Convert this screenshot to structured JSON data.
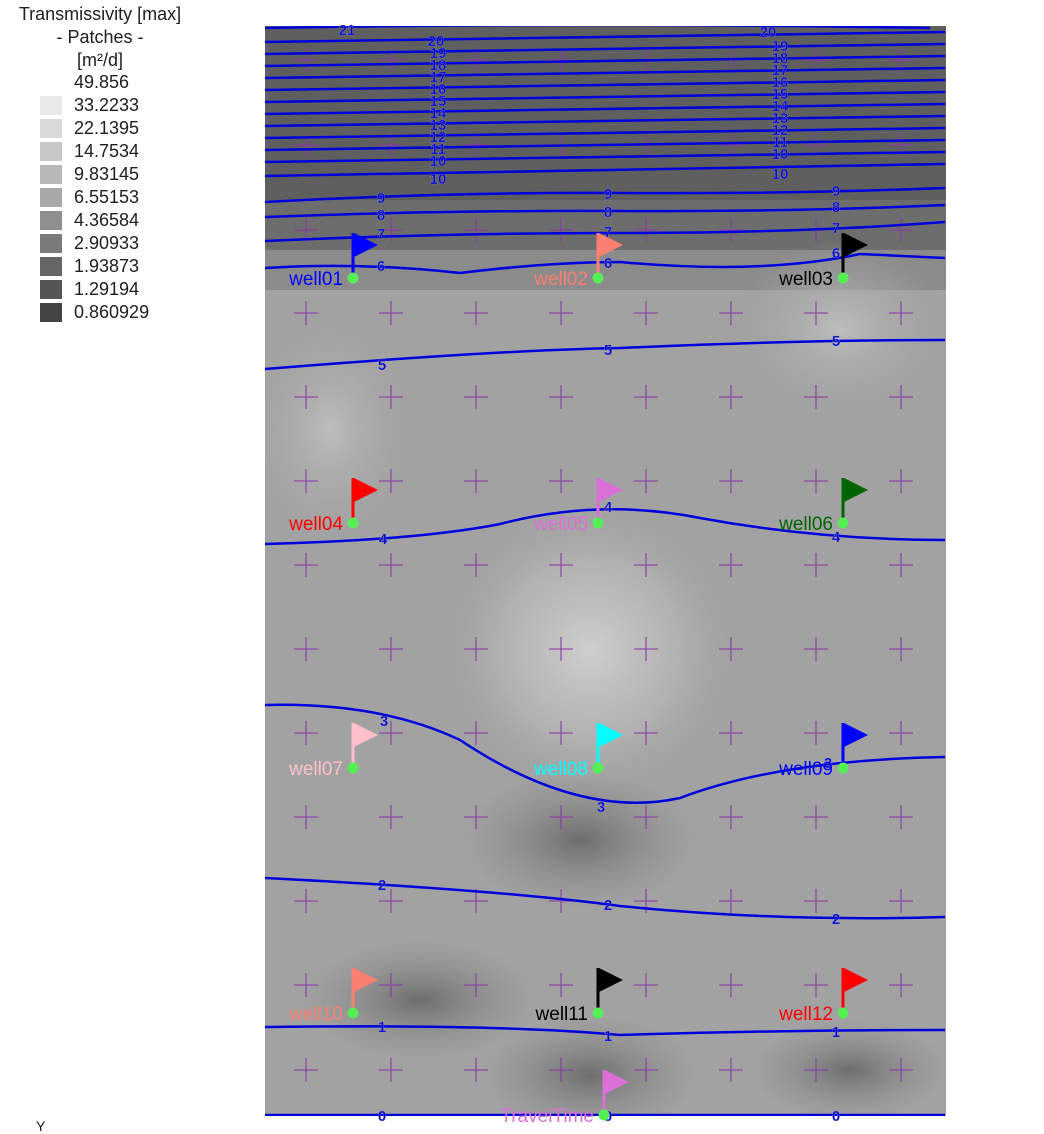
{
  "legend": {
    "title_lines": [
      "Transmissivity [max]",
      "- Patches -",
      "[m²/d]"
    ],
    "top_value": "49.856",
    "classes": [
      {
        "value": "33.2233",
        "color": "#e8e8e8"
      },
      {
        "value": "22.1395",
        "color": "#d9d9d9"
      },
      {
        "value": "14.7534",
        "color": "#c8c8c8"
      },
      {
        "value": "9.83145",
        "color": "#b8b8b8"
      },
      {
        "value": "6.55153",
        "color": "#a8a8a8"
      },
      {
        "value": "4.36584",
        "color": "#8f8f8f"
      },
      {
        "value": "2.90933",
        "color": "#7a7a7a"
      },
      {
        "value": "1.93873",
        "color": "#666666"
      },
      {
        "value": "1.29194",
        "color": "#555555"
      },
      {
        "value": "0.860929",
        "color": "#434343"
      }
    ]
  },
  "contour_color": "#0000dd",
  "contour_labels": [
    "21",
    "20",
    "19",
    "18",
    "17",
    "16",
    "15",
    "14",
    "13",
    "12",
    "11",
    "10",
    "9",
    "8",
    "7",
    "6",
    "5",
    "4",
    "3",
    "2",
    "1",
    "0"
  ],
  "wells": [
    {
      "name": "well01",
      "color": "#0000ff"
    },
    {
      "name": "well02",
      "color": "#fa8072"
    },
    {
      "name": "well03",
      "color": "#000000"
    },
    {
      "name": "well04",
      "color": "#ff0000"
    },
    {
      "name": "well05",
      "color": "#da70d6"
    },
    {
      "name": "well06",
      "color": "#006400"
    },
    {
      "name": "well07",
      "color": "#ffc0cb"
    },
    {
      "name": "well08",
      "color": "#00ffff"
    },
    {
      "name": "well09",
      "color": "#0000ff"
    },
    {
      "name": "well10",
      "color": "#fa8072"
    },
    {
      "name": "well11",
      "color": "#000000"
    },
    {
      "name": "well12",
      "color": "#ff0000"
    },
    {
      "name": "TravelTime",
      "color": "#da70d6"
    }
  ],
  "well_marker_color": "#55ee55",
  "grid_marker_color": "#8a3aa8",
  "bottom_cut_label": "Y"
}
